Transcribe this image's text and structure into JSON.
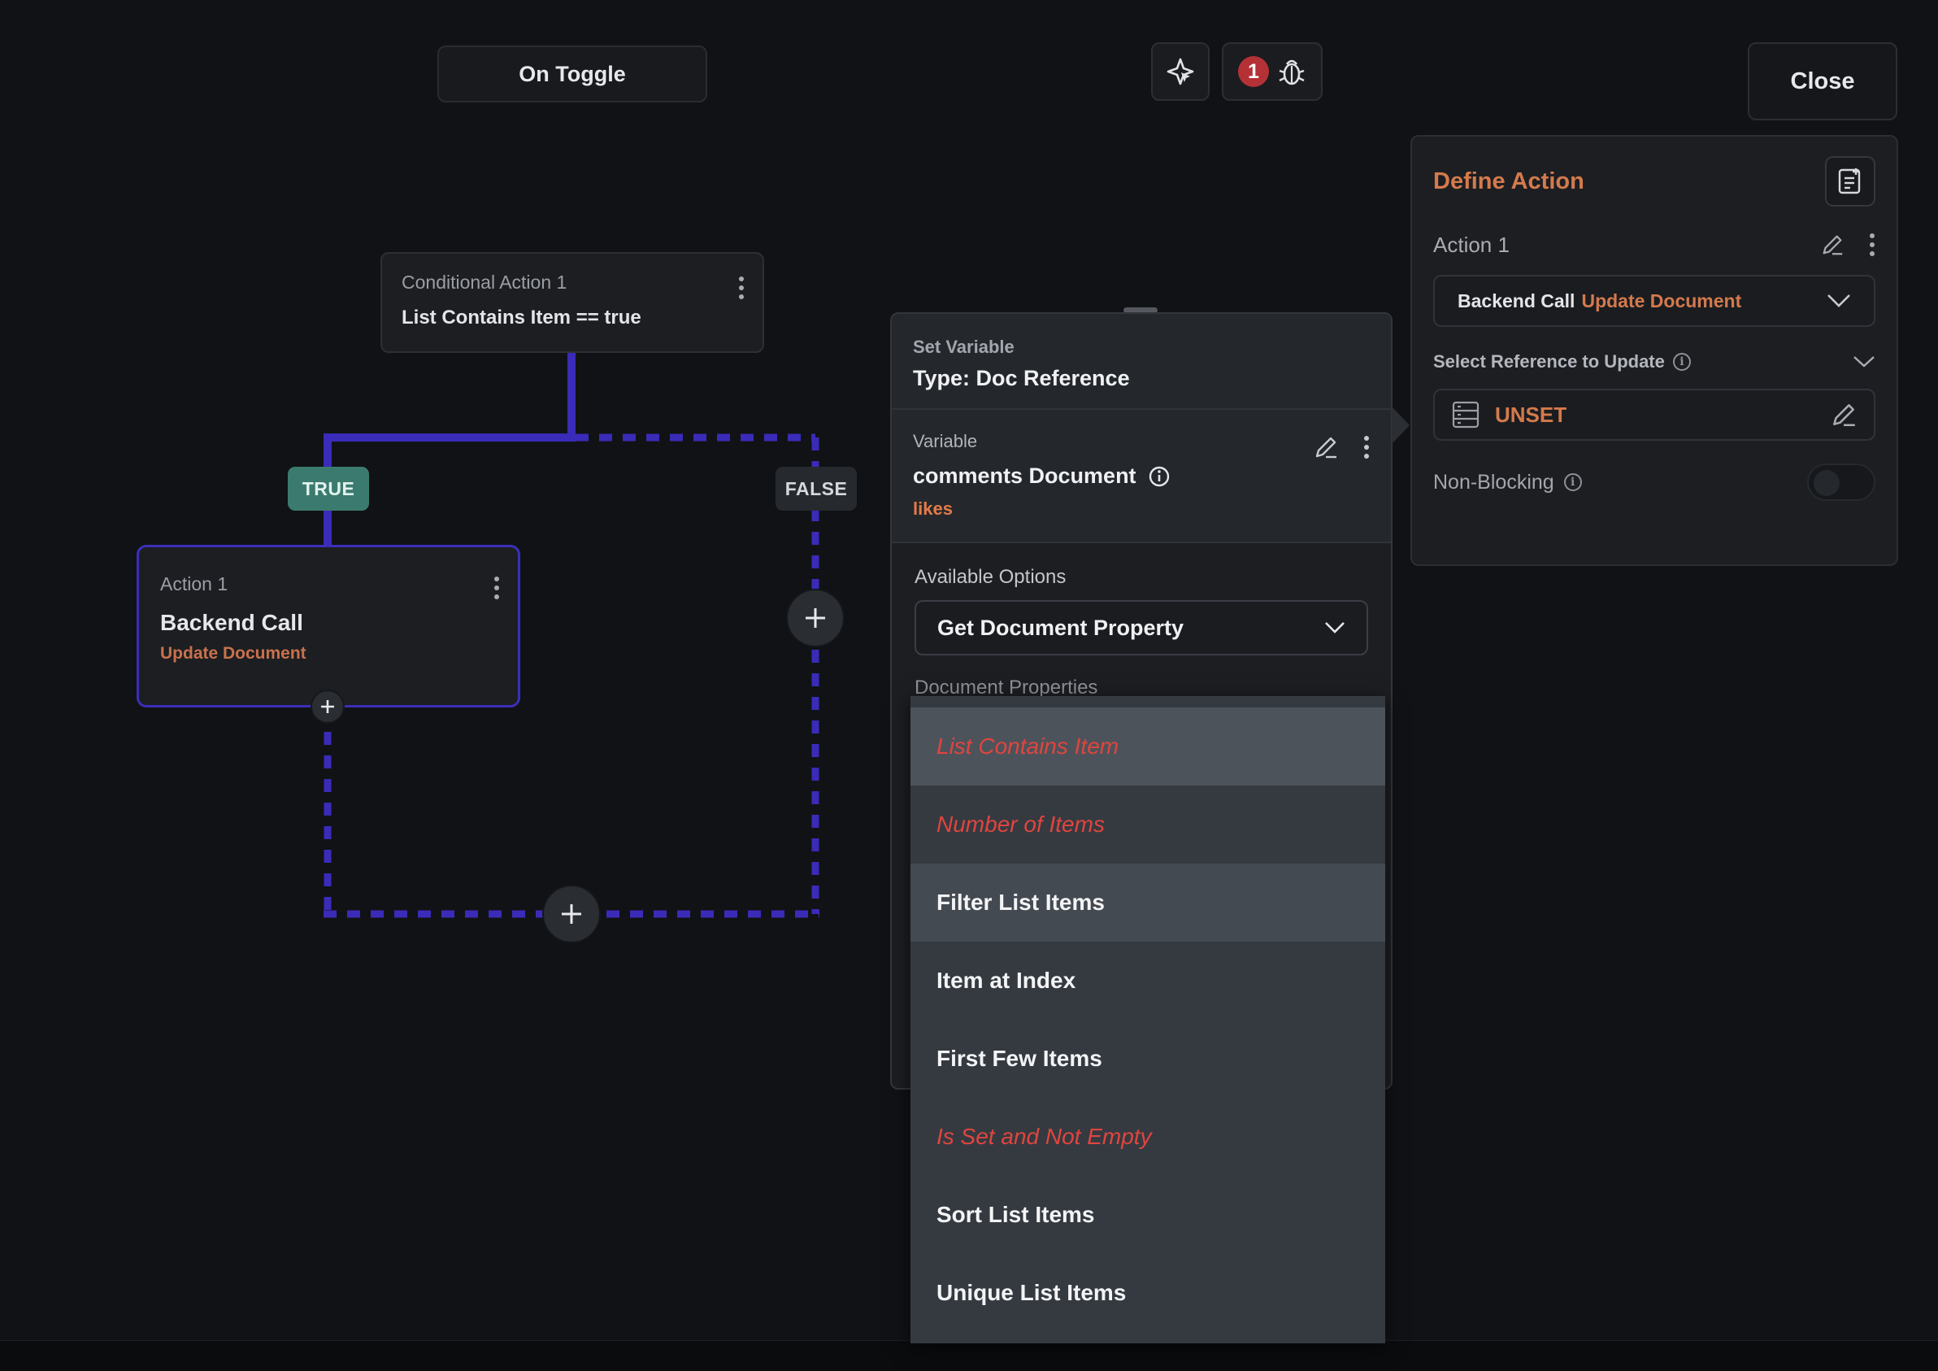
{
  "toolbar": {
    "trigger_label": "On Toggle",
    "debug_count": "1",
    "close_label": "Close"
  },
  "flow": {
    "conditional": {
      "name": "Conditional Action 1",
      "condition": "List Contains Item == true"
    },
    "true_label": "TRUE",
    "false_label": "FALSE",
    "action": {
      "name": "Action 1",
      "type": "Backend Call",
      "subtype": "Update Document"
    }
  },
  "set_variable": {
    "kicker": "Set Variable",
    "type_label": "Type: Doc Reference",
    "variable": {
      "label": "Variable",
      "name": "comments Document",
      "property": "likes"
    },
    "available_options_label": "Available Options",
    "selected_option": "Get Document Property",
    "document_properties_label": "Document Properties",
    "options": [
      {
        "label": "List Contains Item",
        "available": false
      },
      {
        "label": "Number of Items",
        "available": false
      },
      {
        "label": "Filter List Items",
        "available": true
      },
      {
        "label": "Item at Index",
        "available": true
      },
      {
        "label": "First Few Items",
        "available": true
      },
      {
        "label": "Is Set and Not Empty",
        "available": false
      },
      {
        "label": "Sort List Items",
        "available": true
      },
      {
        "label": "Unique List Items",
        "available": true
      }
    ]
  },
  "define_action": {
    "title": "Define Action",
    "action_name": "Action 1",
    "action_type": "Backend Call",
    "action_subtype": "Update Document",
    "reference_label": "Select Reference to Update",
    "reference_value": "UNSET",
    "non_blocking_label": "Non-Blocking",
    "non_blocking_enabled": false
  },
  "colors": {
    "accent_orange": "#d47a4c",
    "flow_line": "#3a2bb8",
    "true_green": "#3b7b6f",
    "error_red": "#e0453e",
    "badge_red": "#b43136"
  },
  "icons": [
    "sparkle-cursor-icon",
    "bug-icon",
    "kebab-icon",
    "plus-icon",
    "pencil-icon",
    "info-icon",
    "chevron-down-icon",
    "database-icon",
    "doc-add-icon"
  ]
}
